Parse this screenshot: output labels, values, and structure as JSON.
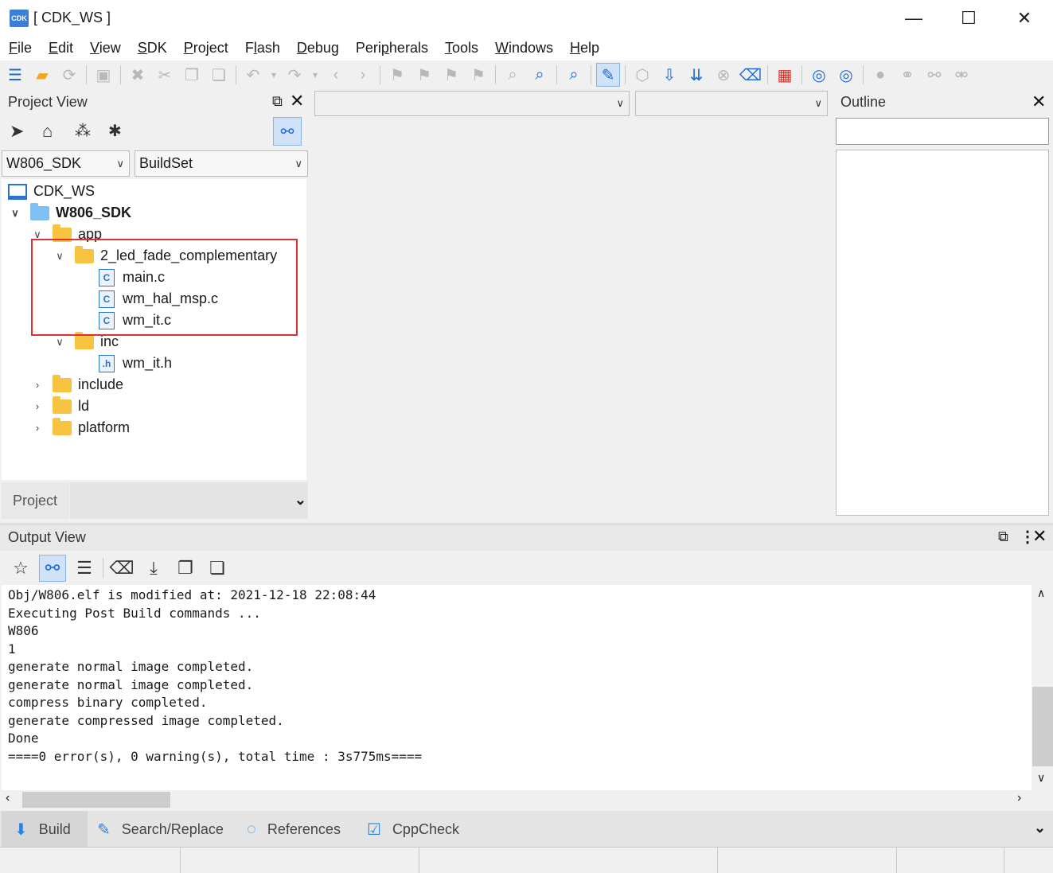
{
  "window": {
    "icon_text": "CDK",
    "title": "[ CDK_WS ]"
  },
  "menu": [
    {
      "pre": "",
      "ul": "F",
      "post": "ile"
    },
    {
      "pre": "",
      "ul": "E",
      "post": "dit"
    },
    {
      "pre": "",
      "ul": "V",
      "post": "iew"
    },
    {
      "pre": "",
      "ul": "S",
      "post": "DK"
    },
    {
      "pre": "",
      "ul": "P",
      "post": "roject"
    },
    {
      "pre": "F",
      "ul": "l",
      "post": "ash"
    },
    {
      "pre": "",
      "ul": "D",
      "post": "ebug"
    },
    {
      "pre": "Peri",
      "ul": "p",
      "post": "herals"
    },
    {
      "pre": "",
      "ul": "T",
      "post": "ools"
    },
    {
      "pre": "",
      "ul": "W",
      "post": "indows"
    },
    {
      "pre": "",
      "ul": "H",
      "post": "elp"
    }
  ],
  "project_view": {
    "title": "Project View",
    "sdk_select": "W806_SDK",
    "buildset_select": "BuildSet",
    "tree": {
      "workspace": "CDK_WS",
      "project": "W806_SDK",
      "app": "app",
      "led_folder": "2_led_fade_complementary",
      "files": [
        "main.c",
        "wm_hal_msp.c",
        "wm_it.c"
      ],
      "inc": "inc",
      "inc_file": "wm_it.h",
      "include": "include",
      "ld": "ld",
      "platform": "platform"
    },
    "bottom_tab": "Project"
  },
  "outline": {
    "title": "Outline"
  },
  "output_view": {
    "title": "Output View",
    "lines": [
      "Obj/W806.elf is modified at: 2021-12-18 22:08:44",
      "Executing Post Build commands ...",
      "W806",
      "1",
      "generate normal image completed.",
      "generate normal image completed.",
      "compress binary completed.",
      "generate compressed image completed.",
      "Done",
      "====0 error(s), 0 warning(s), total time : 3s775ms===="
    ],
    "tabs": {
      "build": "Build",
      "search": "Search/Replace",
      "references": "References",
      "cppcheck": "CppCheck"
    }
  },
  "colors": {
    "highlight_box": "#e03030",
    "accent": "#1d6bd6",
    "folder": "#f6c440"
  }
}
